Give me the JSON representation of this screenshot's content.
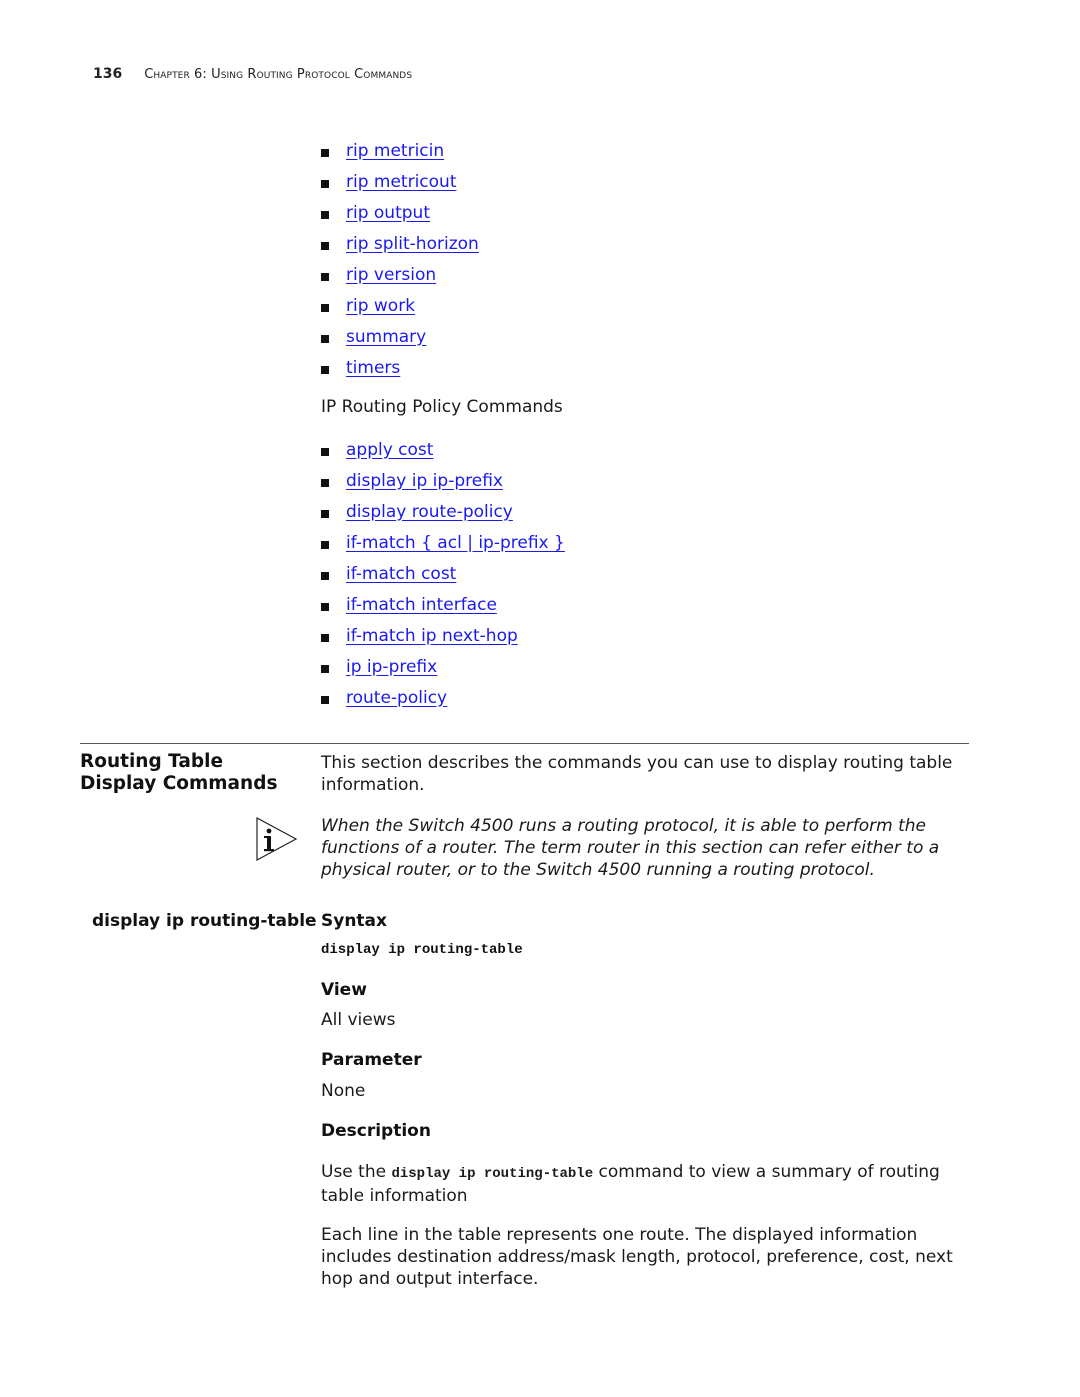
{
  "header": {
    "page_number": "136",
    "chapter": "Chapter 6: Using Routing Protocol Commands"
  },
  "rip_links": [
    "rip metricin",
    "rip metricout",
    "rip output",
    "rip split-horizon",
    "rip version",
    "rip work",
    "summary",
    "timers"
  ],
  "policy_heading": "IP Routing Policy Commands",
  "policy_links": [
    "apply cost ",
    "display ip ip-prefix",
    "display route-policy",
    "if-match { acl | ip-prefix }",
    "if-match cost",
    "if-match interface",
    "if-match ip next-hop",
    "ip ip-prefix",
    "route-policy"
  ],
  "section": {
    "title": "Routing Table Display Commands",
    "intro": "This section describes the commands you can use to display routing table information.",
    "note_icon": "info-icon",
    "note": "When the Switch 4500 runs a routing protocol, it is able to perform the functions of a router. The term router in this section can refer either to a physical router, or to the Switch 4500 running a routing protocol."
  },
  "command": {
    "name": "display ip routing-table",
    "syntax_label": "Syntax",
    "syntax": "display ip routing-table",
    "view_label": "View",
    "view": "All views",
    "parameter_label": "Parameter",
    "parameter": "None",
    "description_label": "Description",
    "desc1_pre": "Use the ",
    "desc1_code": "display ip routing-table",
    "desc1_post": " command to view a summary of routing table information",
    "desc2": "Each line in the table represents one route. The displayed information includes destination address/mask length, protocol, preference, cost, next hop and output interface."
  },
  "colors": {
    "link": "#1a1aee",
    "text": "#1a1a1a"
  }
}
